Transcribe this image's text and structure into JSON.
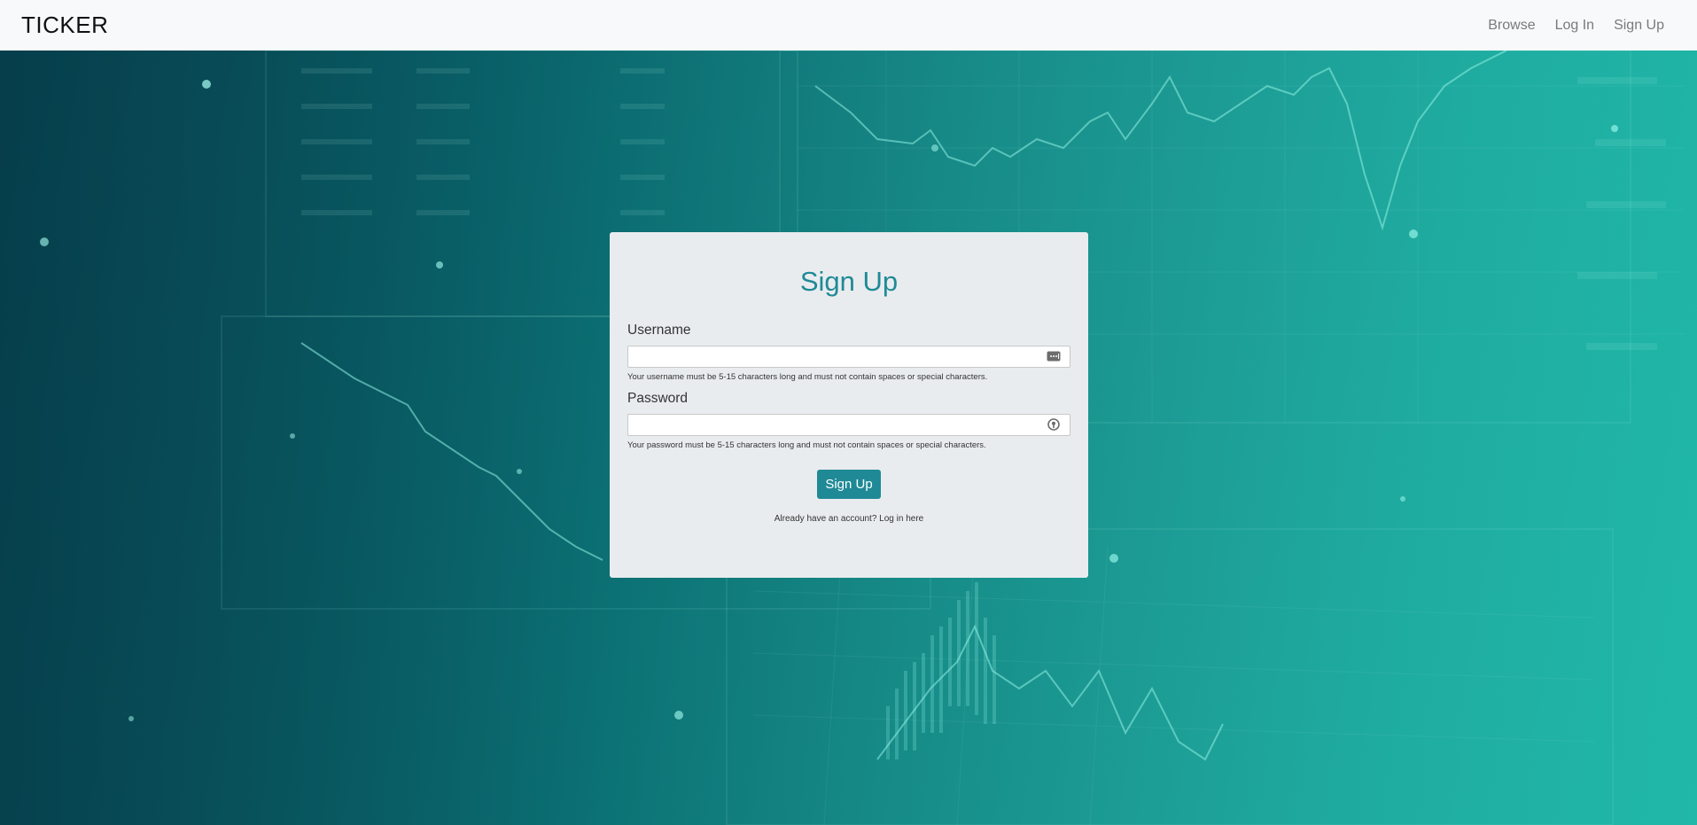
{
  "nav": {
    "brand": "TICKER",
    "links": [
      {
        "label": "Browse"
      },
      {
        "label": "Log In"
      },
      {
        "label": "Sign Up"
      }
    ]
  },
  "form": {
    "title": "Sign Up",
    "username": {
      "label": "Username",
      "value": "",
      "help": "Your username must be 5-15 characters long and must not contain spaces or special characters.",
      "icon": "password-manager-icon"
    },
    "password": {
      "label": "Password",
      "value": "",
      "help": "Your password must be 5-15 characters long and must not contain spaces or special characters.",
      "icon": "key-icon"
    },
    "submit_label": "Sign Up",
    "switch_text": "Already have an account? Log in here"
  },
  "colors": {
    "accent": "#1f8a96",
    "card_bg": "#e9ecef",
    "navbar_bg": "#f8f9fa"
  }
}
